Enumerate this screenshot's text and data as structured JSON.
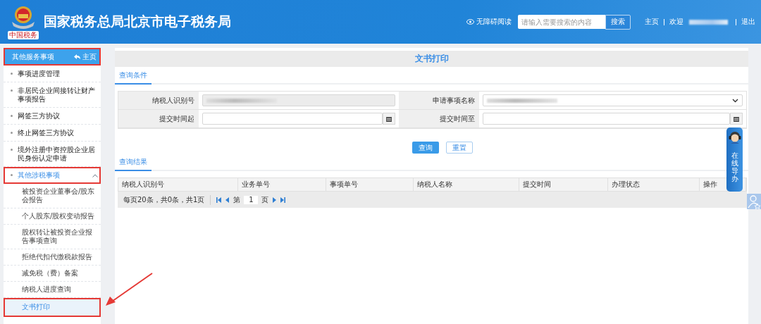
{
  "header": {
    "logo_text": "中国税务",
    "title": "国家税务总局北京市电子税务局",
    "accessibility": "无障碍阅读",
    "search": {
      "placeholder": "请输入需要搜索的内容",
      "button": "搜索"
    },
    "home": "主页",
    "welcome": "欢迎",
    "logout": "退出"
  },
  "sidebar": {
    "header": {
      "title": "其他服务事项",
      "home": "主页",
      "annotated": true
    },
    "items": [
      {
        "label": "事项进度管理",
        "kind": "link",
        "selected": false,
        "annotated": false
      },
      {
        "label": "非居民企业间接转让财产事项报告",
        "kind": "link",
        "selected": false,
        "annotated": false
      },
      {
        "label": "网签三方协议",
        "kind": "link",
        "selected": false,
        "annotated": false
      },
      {
        "label": "终止网签三方协议",
        "kind": "link",
        "selected": false,
        "annotated": false
      },
      {
        "label": "境外注册中资控股企业居民身份认定申请",
        "kind": "link",
        "selected": false,
        "annotated": false
      },
      {
        "label": "其他涉税事项",
        "kind": "group",
        "expanded": true,
        "selected": true,
        "annotated": true,
        "children": [
          {
            "label": "被投资企业董事会/股东会报告",
            "selected": false,
            "annotated": false
          },
          {
            "label": "个人股东/股权变动报告",
            "selected": false,
            "annotated": false
          },
          {
            "label": "股权转让被投资企业报告事项查询",
            "selected": false,
            "annotated": false
          },
          {
            "label": "拒绝代扣代缴税款报告",
            "selected": false,
            "annotated": false
          },
          {
            "label": "减免税（费）备案",
            "selected": false,
            "annotated": false
          },
          {
            "label": "纳税人进度查询",
            "selected": false,
            "annotated": false
          },
          {
            "label": "文书打印",
            "selected": true,
            "annotated": true
          }
        ]
      }
    ]
  },
  "main": {
    "title": "文书打印",
    "query_tab": "查询条件",
    "fields": [
      {
        "label": "纳税人识别号",
        "kind": "readonly"
      },
      {
        "label": "申请事项名称",
        "kind": "select"
      },
      {
        "label": "提交时间起",
        "kind": "date"
      },
      {
        "label": "提交时间至",
        "kind": "date"
      }
    ],
    "buttons": [
      {
        "label": "查询",
        "kind": "primary"
      },
      {
        "label": "重置",
        "kind": "secondary"
      }
    ],
    "result_tab": "查询结果",
    "columns": [
      "纳税人识别号",
      "业务单号",
      "事项单号",
      "纳税人名称",
      "提交时间",
      "办理状态",
      "操作"
    ],
    "pager": {
      "summary": "每页20条，共0条，共1页",
      "prefix": "第",
      "page": "1",
      "suffix": "页"
    }
  },
  "guide": {
    "label": "在线导办"
  }
}
